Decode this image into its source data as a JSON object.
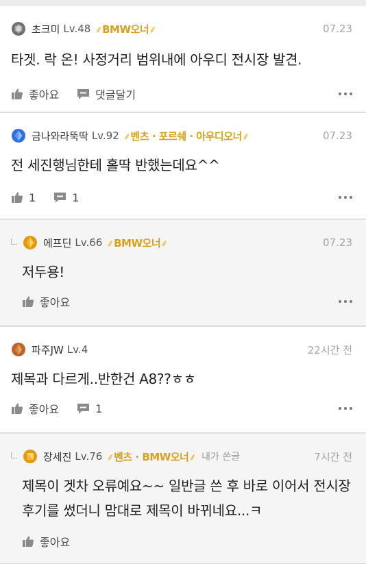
{
  "comments": [
    {
      "nickname": "초크미",
      "level": "Lv.48",
      "owner_badge": "BMW오너",
      "time": "07.23",
      "text": "타겟. 락 온! 사정거리 범위내에 아우디 전시장 발견.",
      "like_label": "좋아요",
      "reply_label": "댓글달기",
      "badge_icon": "gray-medal-icon"
    },
    {
      "nickname": "금나와라뚝딱",
      "level": "Lv.92",
      "owner_badge": "벤츠 · 포르쉐 · 아우디오너",
      "time": "07.23",
      "text": "전 세진행님한테 홀딱 반했는데요^^",
      "like_count": "1",
      "reply_count": "1",
      "badge_icon": "blue-diamond-icon"
    },
    {
      "nickname": "에프딘",
      "level": "Lv.66",
      "owner_badge": "BMW오너",
      "time": "07.23",
      "text": "저두용!",
      "like_label": "좋아요",
      "badge_icon": "gold-gem-icon"
    },
    {
      "nickname": "파주JW",
      "level": "Lv.4",
      "owner_badge": "",
      "time": "22시간 전",
      "text": "제목과 다르게..반한건 A8??ㅎㅎ",
      "like_label": "좋아요",
      "reply_count": "1",
      "badge_icon": "bronze-gem-icon"
    },
    {
      "nickname": "장세진",
      "level": "Lv.76",
      "owner_badge": "벤츠 · BMW오너",
      "mine_label": "내가 쓴글",
      "time": "7시간 전",
      "text": "제목이 겟차 오류예요~~ 일반글 쓴 후 바로 이어서 전시장후기를 썼더니 맘대로 제목이 바뀌네요...ㅋ",
      "like_label": "좋아요",
      "badge_icon": "gold-square-gem-icon"
    }
  ],
  "colors": {
    "owner_gold": "#d6a21d",
    "reply_bg": "#f5f5f5",
    "time_gray": "#a5a5a5"
  }
}
